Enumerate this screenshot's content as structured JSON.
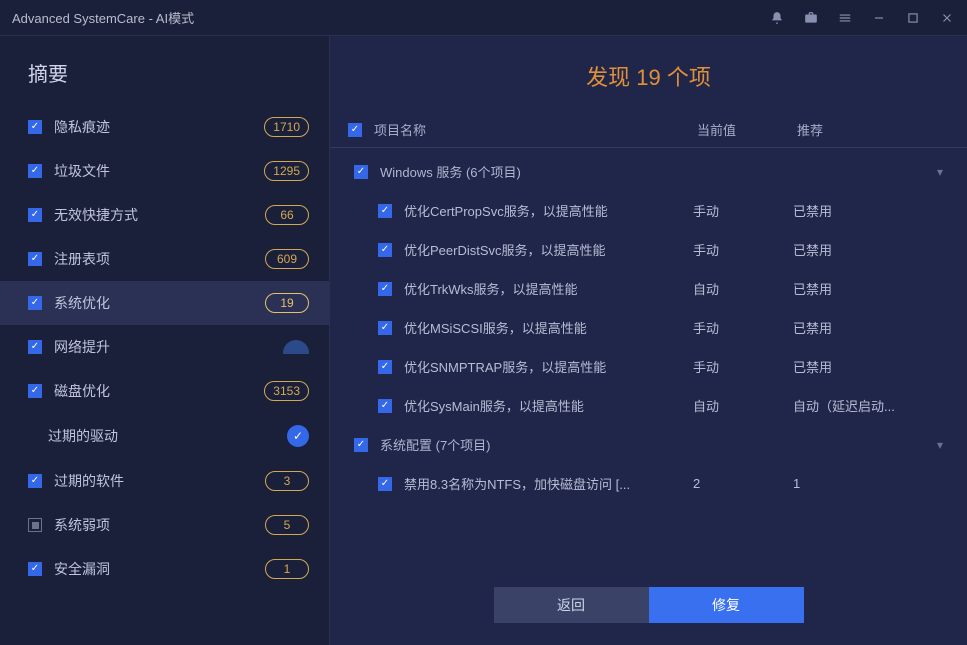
{
  "titlebar": {
    "text": "Advanced SystemCare - AI模式"
  },
  "sidebar": {
    "header": "摘要",
    "items": [
      {
        "label": "隐私痕迹",
        "count": "1710",
        "checked": true
      },
      {
        "label": "垃圾文件",
        "count": "1295",
        "checked": true
      },
      {
        "label": "无效快捷方式",
        "count": "66",
        "checked": true
      },
      {
        "label": "注册表项",
        "count": "609",
        "checked": true
      },
      {
        "label": "系统优化",
        "count": "19",
        "checked": true,
        "active": true
      },
      {
        "label": "网络提升",
        "checked": true,
        "blob": true
      },
      {
        "label": "磁盘优化",
        "count": "3153",
        "checked": true
      },
      {
        "label": "过期的驱动",
        "sub": true,
        "dot": true
      },
      {
        "label": "过期的软件",
        "count": "3",
        "checked": true
      },
      {
        "label": "系统弱项",
        "count": "5",
        "indeterminate": true
      },
      {
        "label": "安全漏洞",
        "count": "1",
        "checked": true
      }
    ]
  },
  "main": {
    "title": "发现 19 个项",
    "cols": {
      "name": "项目名称",
      "current": "当前值",
      "recommended": "推荐"
    },
    "groups": [
      {
        "label": "Windows 服务 (6个项目)",
        "items": [
          {
            "name": "优化CertPropSvc服务，以提高性能",
            "current": "手动",
            "recommended": "已禁用"
          },
          {
            "name": "优化PeerDistSvc服务，以提高性能",
            "current": "手动",
            "recommended": "已禁用"
          },
          {
            "name": "优化TrkWks服务，以提高性能",
            "current": "自动",
            "recommended": "已禁用"
          },
          {
            "name": "优化MSiSCSI服务，以提高性能",
            "current": "手动",
            "recommended": "已禁用"
          },
          {
            "name": "优化SNMPTRAP服务，以提高性能",
            "current": "手动",
            "recommended": "已禁用"
          },
          {
            "name": "优化SysMain服务，以提高性能",
            "current": "自动",
            "recommended": "自动（延迟启动..."
          }
        ]
      },
      {
        "label": "系统配置 (7个项目)",
        "items": [
          {
            "name": "禁用8.3名称为NTFS，加快磁盘访问 [...",
            "current": "2",
            "recommended": "1"
          }
        ]
      }
    ],
    "buttons": {
      "back": "返回",
      "fix": "修复"
    }
  }
}
